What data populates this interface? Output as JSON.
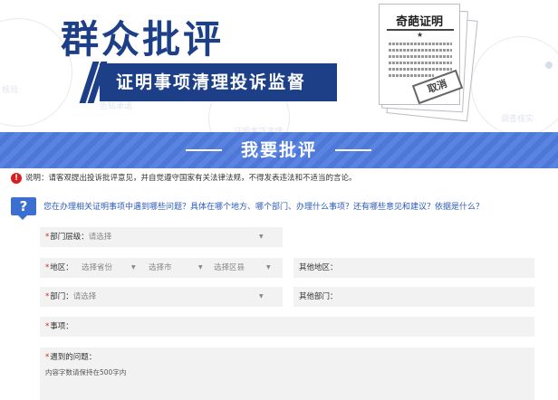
{
  "banner": {
    "title": "群众批评",
    "subtitle": "证明事项清理投诉监督",
    "doc_title": "奇葩证明",
    "stamp": "取消",
    "deco_left": "核验",
    "deco_mid": "告知承诺",
    "deco_right": "调查核实",
    "deco_top": "证明事项清理"
  },
  "section": {
    "title": "我要批评"
  },
  "notice": {
    "icon": "exclamation-icon",
    "text": "说明：请客观提出投诉批评意见，并自觉遵守国家有关法律法规，不得发表违法和不适当的言论。"
  },
  "question": {
    "icon": "?",
    "text": "您在办理相关证明事项中遇到哪些问题？具体在哪个地方、哪个部门、办理什么事项？还有哪些意见和建议？依据是什么？"
  },
  "form": {
    "dept_level": {
      "label": "部门层级：",
      "placeholder": "请选择"
    },
    "region": {
      "label": "地区：",
      "province": "选择省份",
      "city": "选择市",
      "district": "选择区县"
    },
    "other_region": {
      "label": "其他地区："
    },
    "department": {
      "label": "部门：",
      "placeholder": "请选择"
    },
    "other_department": {
      "label": "其他部门："
    },
    "matter": {
      "label": "事项："
    },
    "problem": {
      "label": "遇到的问题：",
      "hint": "内容字数请保持在500字内"
    }
  },
  "colors": {
    "brand_blue": "#1c3f88",
    "bar_blue": "#5a84e0",
    "required_red": "#e02020",
    "question_blue": "#2b5bb8"
  }
}
